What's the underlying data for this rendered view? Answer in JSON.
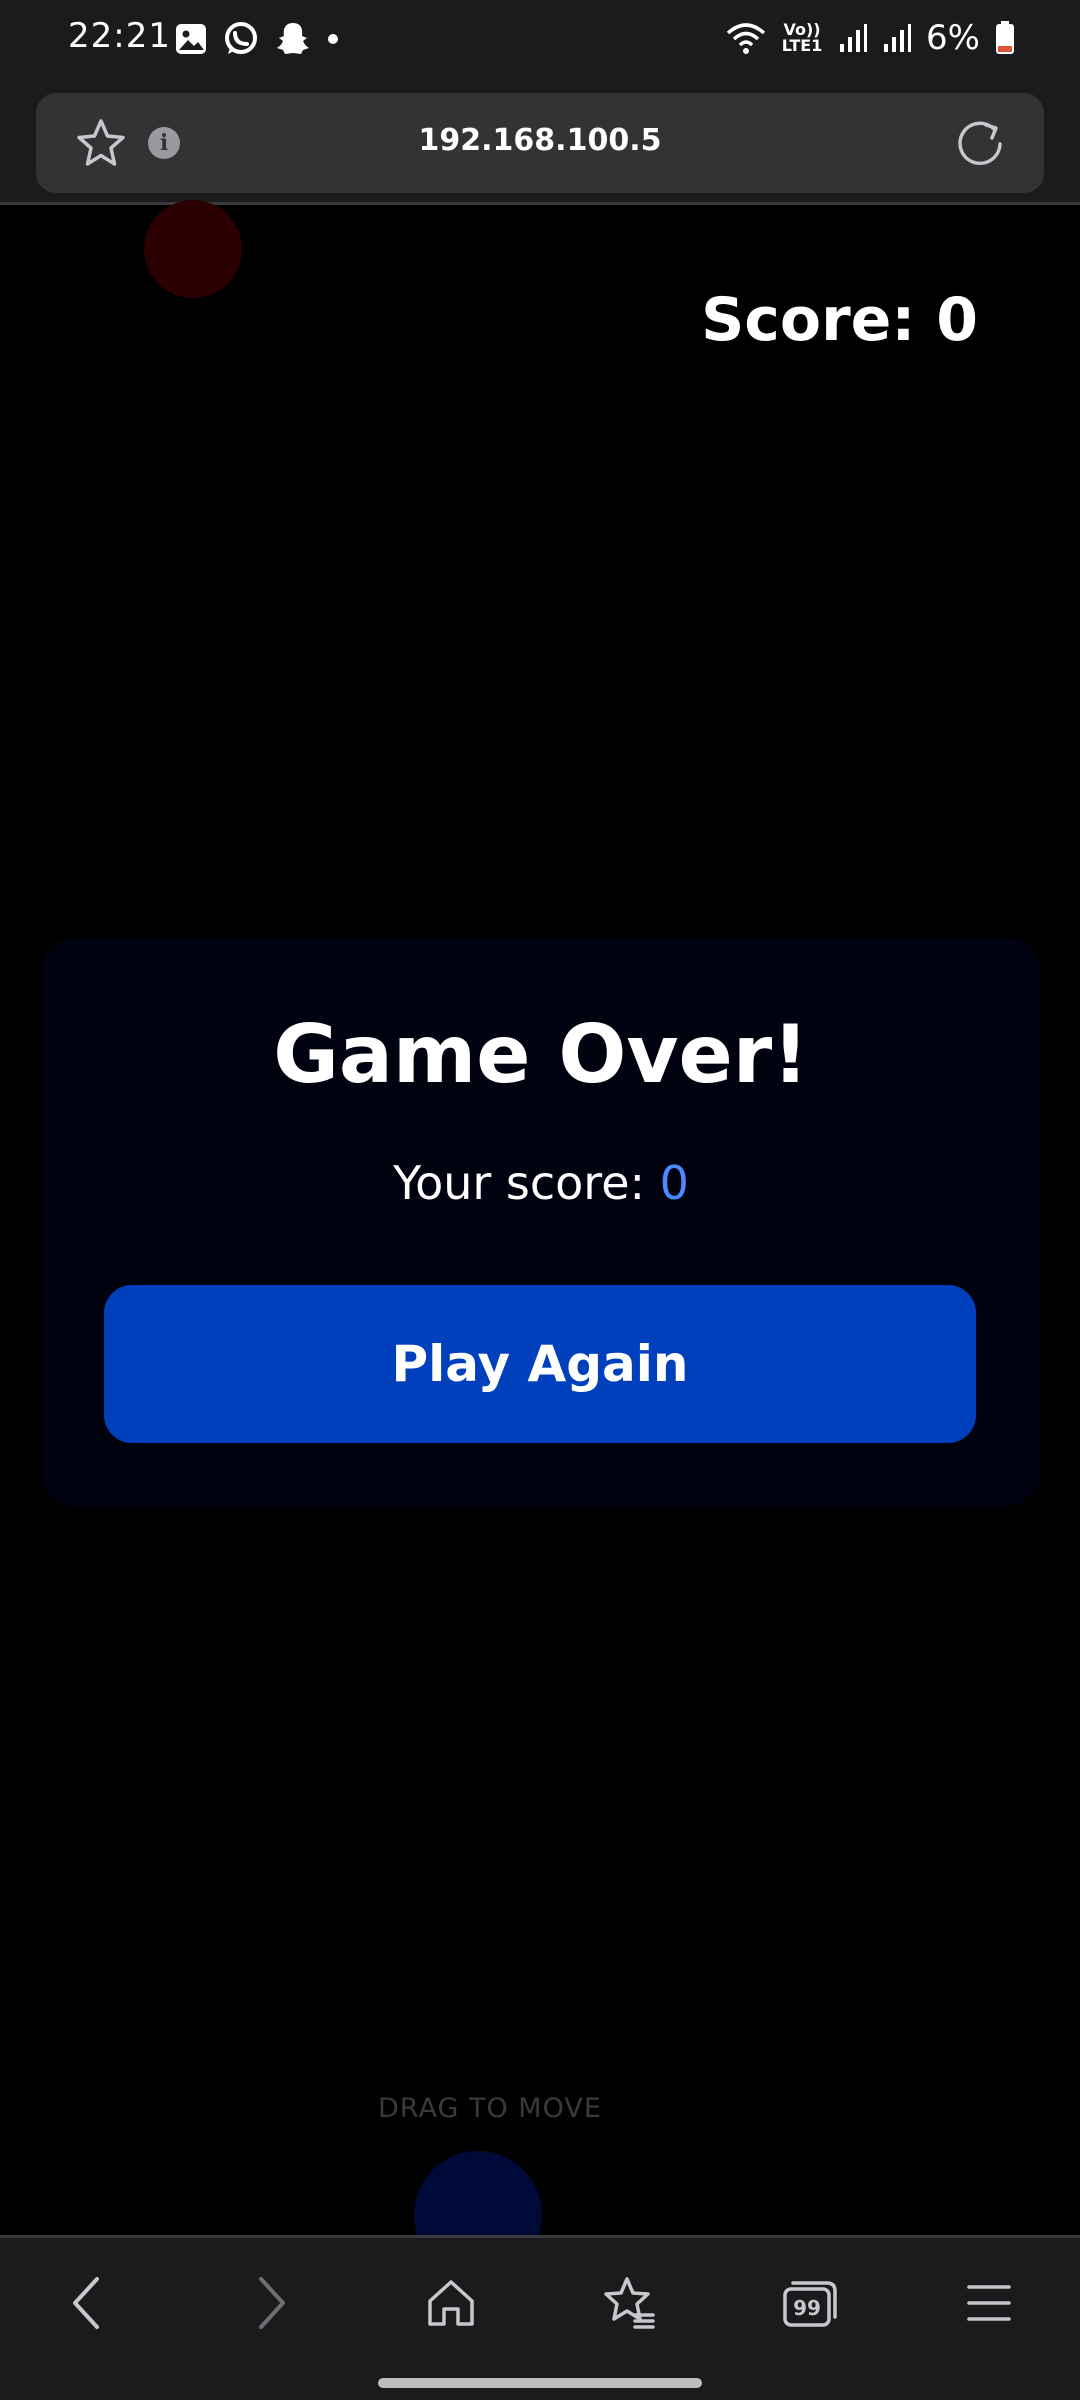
{
  "status_bar": {
    "time": "22:21",
    "battery": "6%",
    "network_label": "Vo)) LTE1",
    "icons": [
      "gallery-icon",
      "whatsapp-icon",
      "snapchat-icon",
      "dot-icon",
      "wifi-icon",
      "signal-icon",
      "signal-icon",
      "battery-icon"
    ]
  },
  "browser": {
    "url": "192.168.100.5",
    "info_glyph": "i"
  },
  "game": {
    "score_label": "Score: 0",
    "dialog": {
      "title": "Game Over!",
      "your_score_label": "Your score:",
      "your_score_value": "0",
      "button_label": "Play Again"
    },
    "hint": "DRAG TO MOVE"
  },
  "bottom_nav": {
    "tabs_count": "99",
    "items": [
      "back-icon",
      "forward-icon",
      "home-icon",
      "bookmarks-icon",
      "tabs-icon",
      "menu-icon"
    ]
  },
  "colors": {
    "background": "#000000",
    "panel": "#01020f",
    "button": "#0040bd",
    "score_value": "#4a8cff",
    "enemy": "#2a0000",
    "player": "#000a38"
  }
}
